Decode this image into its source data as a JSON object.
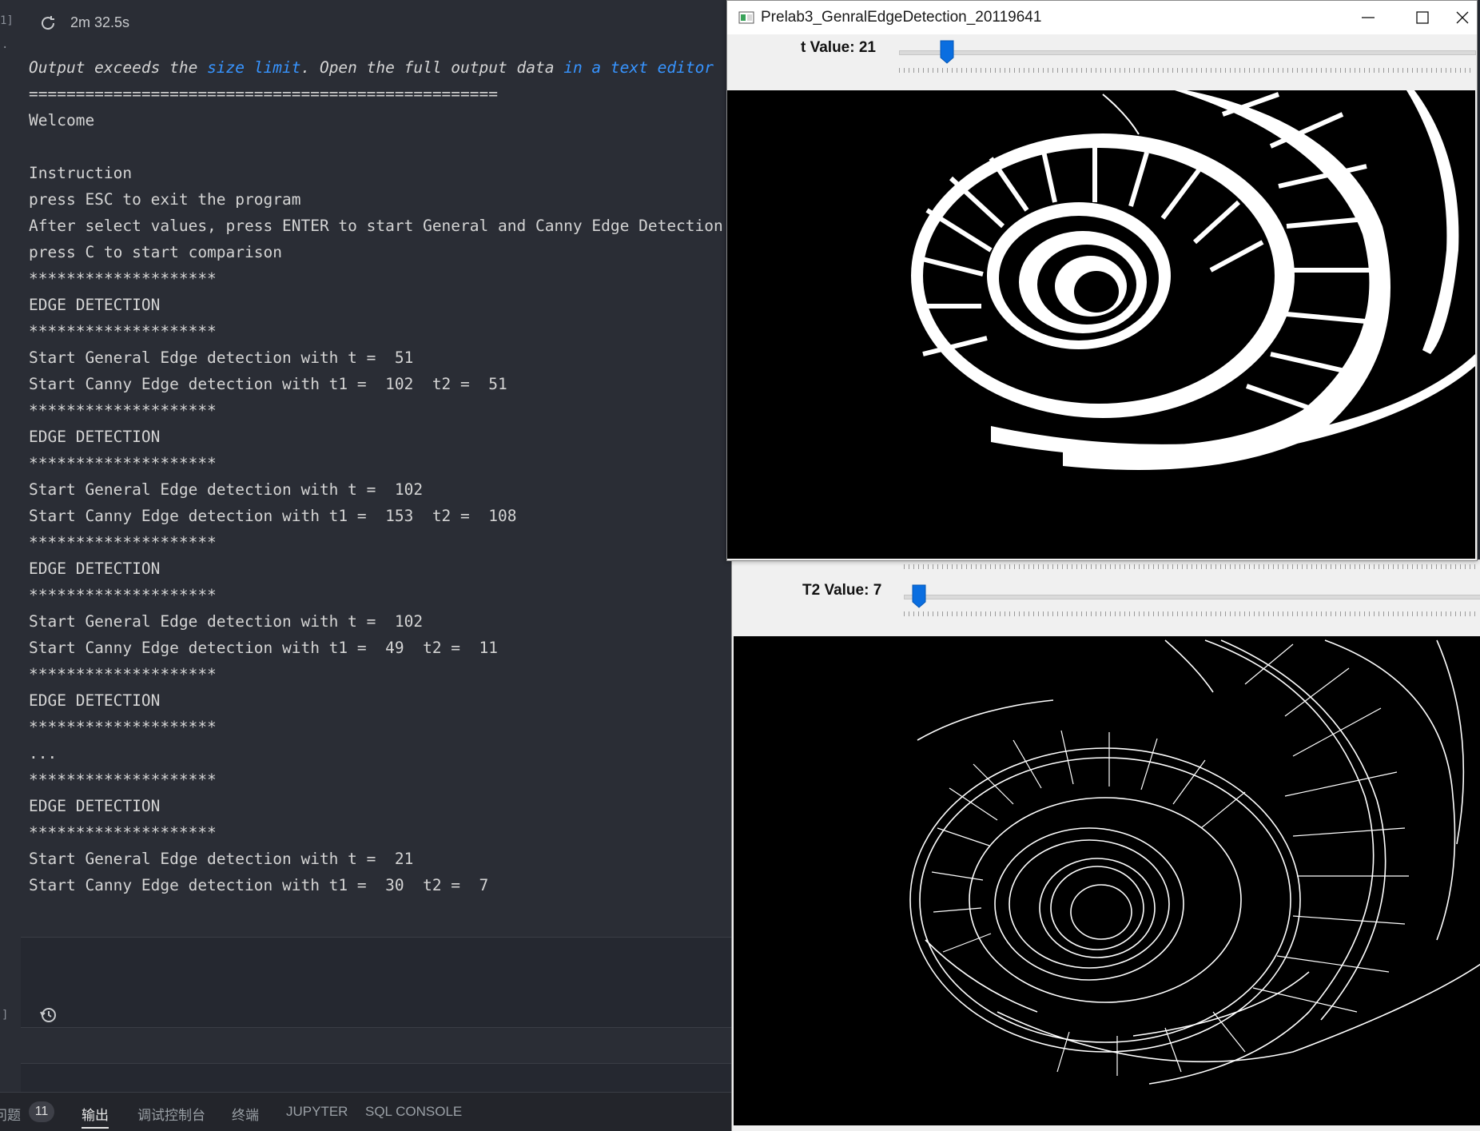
{
  "editor": {
    "cell_gutter_top": "1]",
    "cell_gutter_dot": "·",
    "run_time": "2m 32.5s",
    "warning": {
      "p1": "Output exceeds the ",
      "link1": "size limit",
      "p2": ". Open the full output data ",
      "link2": "in a text editor"
    },
    "output_lines": [
      "==================================================",
      "Welcome",
      "",
      "Instruction",
      "press ESC to exit the program",
      "After select values, press ENTER to start General and Canny Edge Detection",
      "press C to start comparison",
      "********************",
      "EDGE DETECTION",
      "********************",
      "Start General Edge detection with t =  51",
      "Start Canny Edge detection with t1 =  102  t2 =  51",
      "********************",
      "EDGE DETECTION",
      "********************",
      "Start General Edge detection with t =  102",
      "Start Canny Edge detection with t1 =  153  t2 =  108",
      "********************",
      "EDGE DETECTION",
      "********************",
      "Start General Edge detection with t =  102",
      "Start Canny Edge detection with t1 =  49  t2 =  11",
      "********************",
      "EDGE DETECTION",
      "********************",
      "...",
      "********************",
      "EDGE DETECTION",
      "********************",
      "Start General Edge detection with t =  21",
      "Start Canny Edge detection with t1 =  30  t2 =  7"
    ],
    "cell2_gutter": "]",
    "panel": {
      "problems_label": "问题",
      "problems_count": "11",
      "tabs": [
        "输出",
        "调试控制台",
        "终端",
        "JUPYTER",
        "SQL CONSOLE"
      ],
      "active_tab": "输出"
    }
  },
  "window1": {
    "title": "Prelab3_GenralEdgeDetection_20119641",
    "trackbar_label": "t Value: 21",
    "trackbar_value": 21
  },
  "window2": {
    "trackbar_label": "T2 Value: 7",
    "trackbar_value": 7
  },
  "colors": {
    "link": "#3794ff",
    "trackbar_thumb": "#0a6ee0",
    "editor_bg": "#2a2d35"
  }
}
